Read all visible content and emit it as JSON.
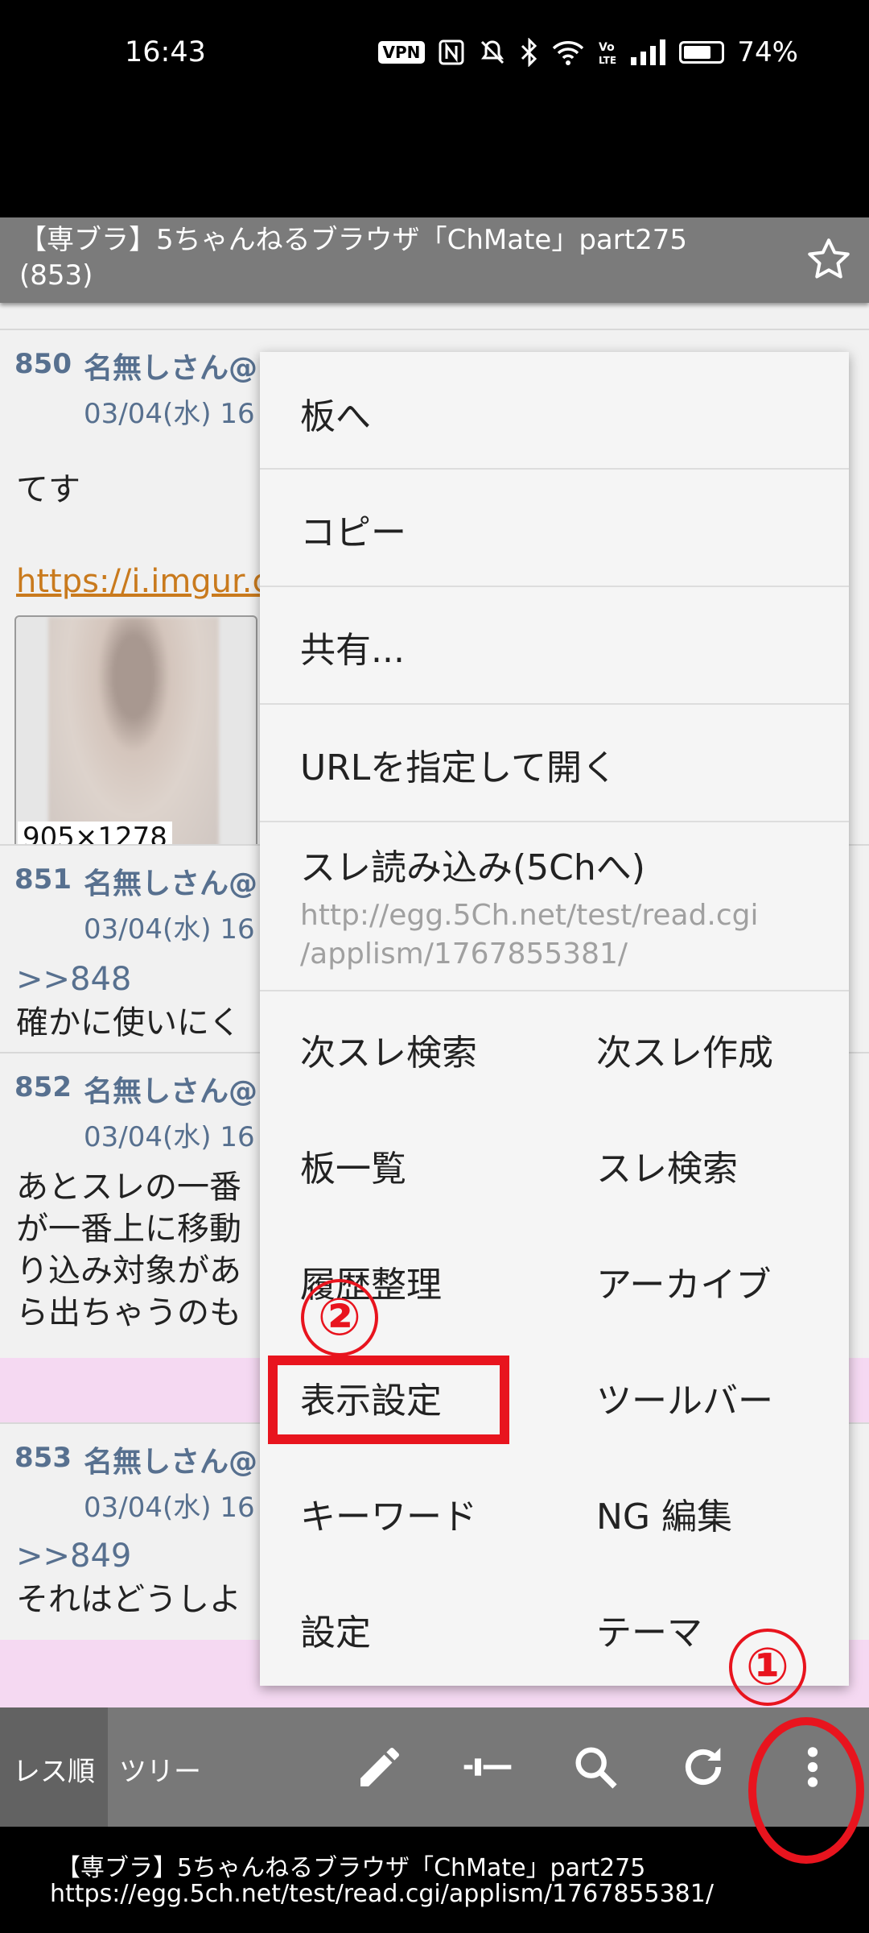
{
  "status": {
    "time": "16:43",
    "vpn_label": "VPN",
    "battery": "74%",
    "battery_level": 0.74
  },
  "header": {
    "title": "【専ブラ】5ちゃんねるブラウザ「ChMate」part275",
    "count": "(853)"
  },
  "posts": [
    {
      "num": "850",
      "name": "名無しさん@",
      "date": "03/04(水) 16",
      "body": [
        "てす"
      ],
      "link": "https://i.imgur.c",
      "image_dims": "905×1278"
    },
    {
      "num": "851",
      "name": "名無しさん@",
      "date": "03/04(水) 16",
      "anchor": ">>848",
      "body": [
        "確かに使いにく"
      ]
    },
    {
      "num": "852",
      "name": "名無しさん@",
      "date": "03/04(水) 16",
      "body": [
        "あとスレの一番",
        "が一番上に移動",
        "り込み対象があ",
        "ら出ちゃうのも"
      ]
    },
    {
      "num": "853",
      "name": "名無しさん@",
      "date": "03/04(水) 16",
      "anchor": ">>849",
      "body": [
        "それはどうしよ"
      ]
    }
  ],
  "menu": {
    "to_board": "板へ",
    "copy": "コピー",
    "share": "共有...",
    "open_url": "URLを指定して開く",
    "reload": "スレ読み込み(5Chへ)",
    "reload_url_1": "http://egg.5Ch.net/test/read.cgi",
    "reload_url_2": "/applism/1767855381/",
    "grid": [
      [
        "次スレ検索",
        "次スレ作成"
      ],
      [
        "板一覧",
        "スレ検索"
      ],
      [
        "履歴整理",
        "アーカイブ"
      ],
      [
        "表示設定",
        "ツールバー"
      ],
      [
        "キーワード",
        "NG 編集"
      ],
      [
        "設定",
        "テーマ"
      ]
    ]
  },
  "annotations": {
    "step1": "①",
    "step2": "②"
  },
  "toolbar": {
    "tab_order": "レス順",
    "tab_tree": "ツリー"
  },
  "notification": {
    "title": "【専ブラ】5ちゃんねるブラウザ「ChMate」part275",
    "url": "https://egg.5ch.net/test/read.cgi/applism/1767855381/"
  },
  "icons": [
    "vpn-icon",
    "nfc-icon",
    "mute-icon",
    "bluetooth-icon",
    "wifi-icon",
    "volte-icon",
    "signal-icon",
    "battery-icon",
    "star-icon",
    "pencil-icon",
    "slider-icon",
    "search-icon",
    "refresh-icon",
    "more-vert-icon"
  ],
  "colors": {
    "accent_red": "#e8141e",
    "name_blue": "#57708f",
    "link_orange": "#c97a1d",
    "toolbar_gray": "#787878"
  }
}
